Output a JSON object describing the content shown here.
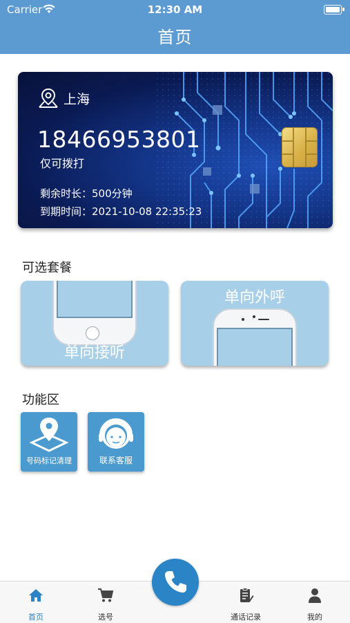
{
  "status_bar": {
    "carrier": "Carrier",
    "time": "12:30 AM"
  },
  "nav": {
    "title": "首页"
  },
  "card": {
    "location": "上海",
    "phone_number": "18466953801",
    "restriction": "仅可拨打",
    "remaining": "剩余时长：500分钟",
    "expiry": "到期时间：2021-10-08 22:35:23"
  },
  "plans": {
    "title": "可选套餐",
    "items": [
      {
        "label": "单向接听"
      },
      {
        "label": "单向外呼"
      }
    ]
  },
  "functions": {
    "title": "功能区",
    "items": [
      {
        "label": "号码标记清理",
        "icon": "map-pin-icon"
      },
      {
        "label": "联系客服",
        "icon": "customer-service-icon"
      }
    ]
  },
  "tabbar": {
    "items": [
      {
        "label": "首页",
        "icon": "home-icon",
        "active": true
      },
      {
        "label": "选号",
        "icon": "cart-icon"
      },
      {
        "label": "",
        "icon": "phone-call-icon"
      },
      {
        "label": "通话记录",
        "icon": "call-log-icon"
      },
      {
        "label": "我的",
        "icon": "user-icon"
      }
    ]
  },
  "colors": {
    "nav": "#5b9bd1",
    "accent": "#2b84c6",
    "plan_bg": "#a8cfe8",
    "func_bg": "#4a99cf"
  }
}
